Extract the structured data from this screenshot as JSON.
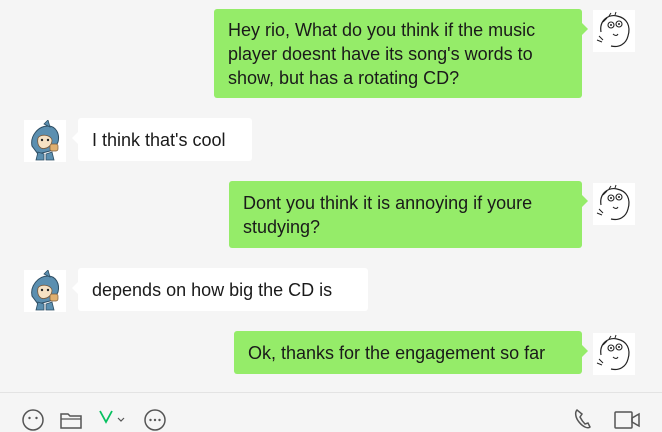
{
  "conversation": {
    "messages": [
      {
        "sender": "me",
        "text": "Hey rio, What do you think if the music\nplayer doesnt have its song's words to\nshow, but has a rotating CD?"
      },
      {
        "sender": "them",
        "text": "I think that's cool"
      },
      {
        "sender": "me",
        "text": "Dont you think it is annoying if youre\nstudying?"
      },
      {
        "sender": "them",
        "text": "depends on how big the CD is"
      },
      {
        "sender": "me",
        "text": "Ok, thanks for the engagement so far"
      }
    ]
  },
  "toolbar": {
    "icons": [
      "emoji-icon",
      "folder-icon",
      "scissors-icon",
      "chat-history-icon",
      "phone-icon",
      "video-call-icon"
    ],
    "accent_color": "#07c160"
  },
  "colors": {
    "my_bubble": "#95ec69",
    "their_bubble": "#ffffff",
    "background": "#f5f5f5"
  }
}
